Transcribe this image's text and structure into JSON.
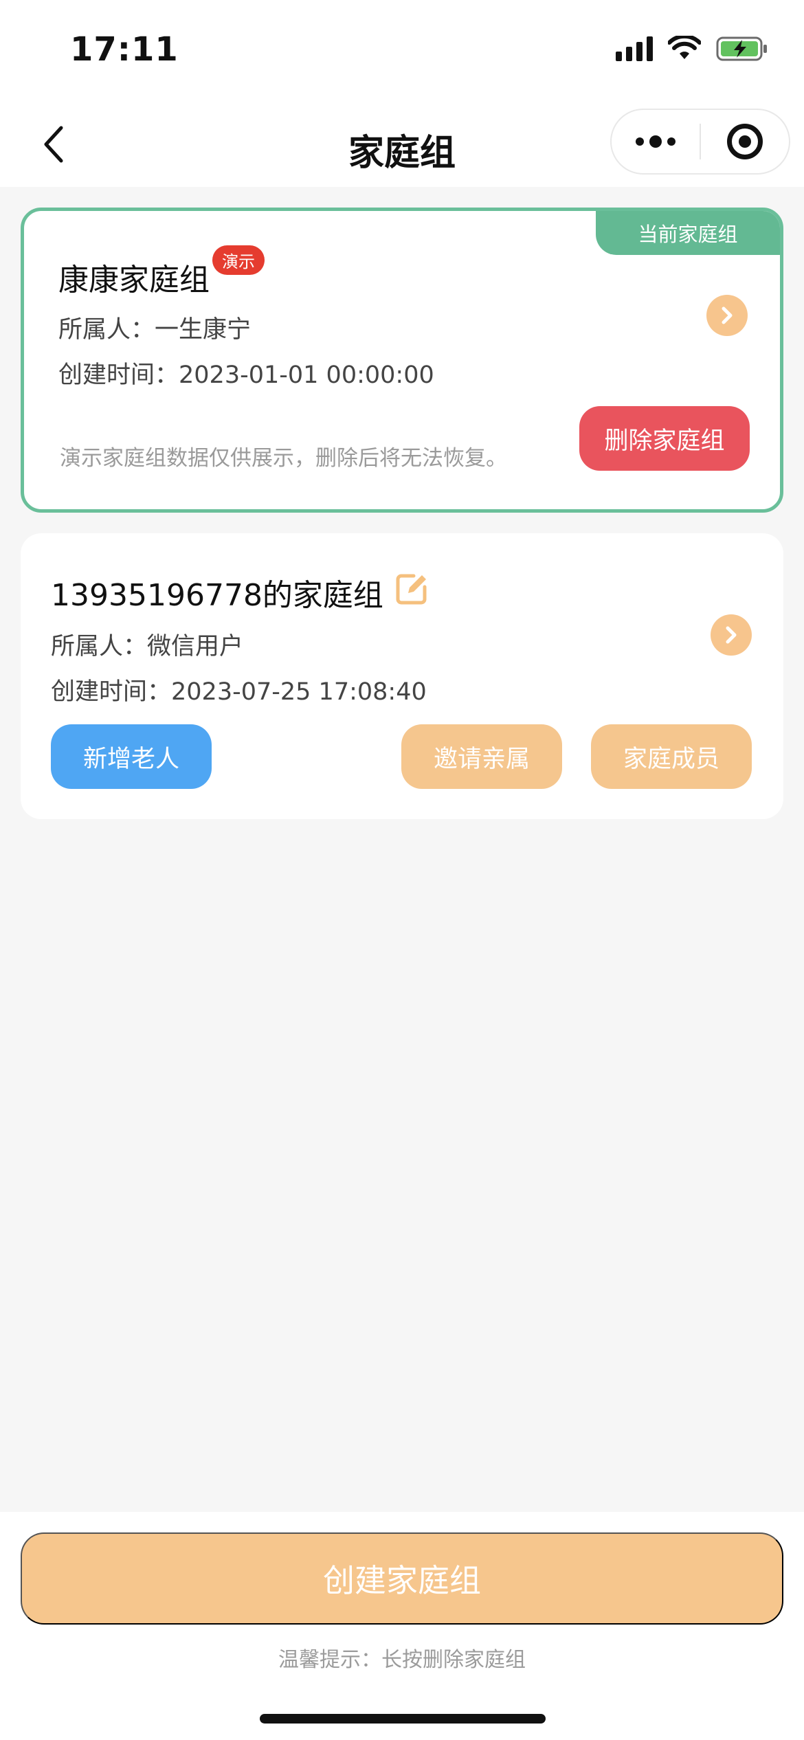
{
  "status_bar": {
    "time": "17:11"
  },
  "nav": {
    "title": "家庭组"
  },
  "colors": {
    "accent_orange": "#f6c68d",
    "current_green": "#63b993",
    "delete_red": "#e9545d",
    "add_blue": "#4fa6f3",
    "demo_badge_red": "#e53c2f"
  },
  "groups": [
    {
      "name": "康康家庭组",
      "badge": "演示",
      "current_tag": "当前家庭组",
      "owner_label": "所属人：",
      "owner": "一生康宁",
      "created_label": "创建时间：",
      "created": "2023-01-01 00:00:00",
      "note": "演示家庭组数据仅供展示，删除后将无法恢复。",
      "delete_label": "删除家庭组"
    },
    {
      "name": "13935196778的家庭组",
      "owner_label": "所属人：",
      "owner": "微信用户",
      "created_label": "创建时间：",
      "created": "2023-07-25 17:08:40",
      "add_label": "新增老人",
      "invite_label": "邀请亲属",
      "members_label": "家庭成员"
    }
  ],
  "bottom": {
    "create_label": "创建家庭组",
    "tip": "温馨提示：长按删除家庭组"
  }
}
